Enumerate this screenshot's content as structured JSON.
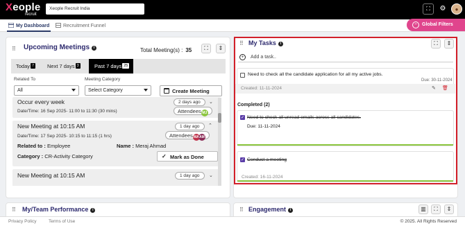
{
  "app": {
    "logo_word": "eople",
    "logo_x": "X",
    "logo_sub": "recruit",
    "search_value": "Xeople Recruit India"
  },
  "tabs": [
    {
      "label": "My Dashboard",
      "active": true
    },
    {
      "label": "Recruitment Funnel",
      "active": false
    }
  ],
  "global_filters": "Global Filters",
  "meetings": {
    "title": "Upcoming Meetings",
    "total_label": "Total Meeting(s) :",
    "total_value": "35",
    "range_tabs": [
      {
        "label": "Today",
        "count": "7"
      },
      {
        "label": "Next 7 days",
        "count": "3"
      },
      {
        "label": "Past 7 days",
        "count": "25",
        "active": true
      }
    ],
    "related_to_label": "Related To",
    "related_to_value": "All",
    "category_label": "Meeting Category",
    "category_placeholder": "Select Category",
    "create_label": "Create Meeting",
    "items": [
      {
        "title": "Occur every week",
        "date": "Date/Time: 16 Sep 2025- 11:00 to 11:30 (30 mins)",
        "ago": "2 days ago",
        "attendees_label": "Attendees",
        "avatars": [
          "MJ"
        ]
      },
      {
        "title": "New Meeting at 10:15 AM",
        "date": "Date/Time: 17 Sep 2025- 10:15 to 11:15 (1 hrs)",
        "ago": "1 day ago",
        "attendees_label": "Attendees",
        "avatars": [
          "MA",
          "AM"
        ],
        "related_key": "Related to :",
        "related_val": "Employee",
        "name_key": "Name :",
        "name_val": "Meraj Ahmad",
        "category_key": "Category :",
        "category_val": "CR-Activity Category",
        "mark_done": "Mark as Done"
      },
      {
        "title": "New Meeting at 10:15 AM",
        "ago": "1 day ago"
      }
    ]
  },
  "tasks": {
    "title": "My Tasks",
    "add_placeholder": "Add a task..",
    "pending": [
      {
        "text": "Need to check all the candidate application for all my active jobs.",
        "due": "Due: 30-11-2024",
        "created": "Created: 11-11-2024"
      }
    ],
    "completed_heading": "Completed (2)",
    "completed": [
      {
        "text": "Need to check all unread emails across all candidates.",
        "due": "Due: 11-11-2024"
      },
      {
        "text": "Conduct a meeting",
        "created": "Created: 16-11-2024"
      }
    ]
  },
  "performance": {
    "title": "My/Team Performance"
  },
  "engagement": {
    "title": "Engagement"
  },
  "footer": {
    "privacy": "Privacy Policy",
    "terms": "Terms of Use",
    "copyright": "© 2025. All Rights Reserved"
  },
  "colors": {
    "topbar": "#000000",
    "accent_pink": "#e0458d",
    "title_navy": "#2d2a6e",
    "task_highlight": "#d21f2a",
    "pending_bar": "#e0458d",
    "completed_bar": "#8cc63f",
    "checkbox": "#5b3ea8"
  }
}
